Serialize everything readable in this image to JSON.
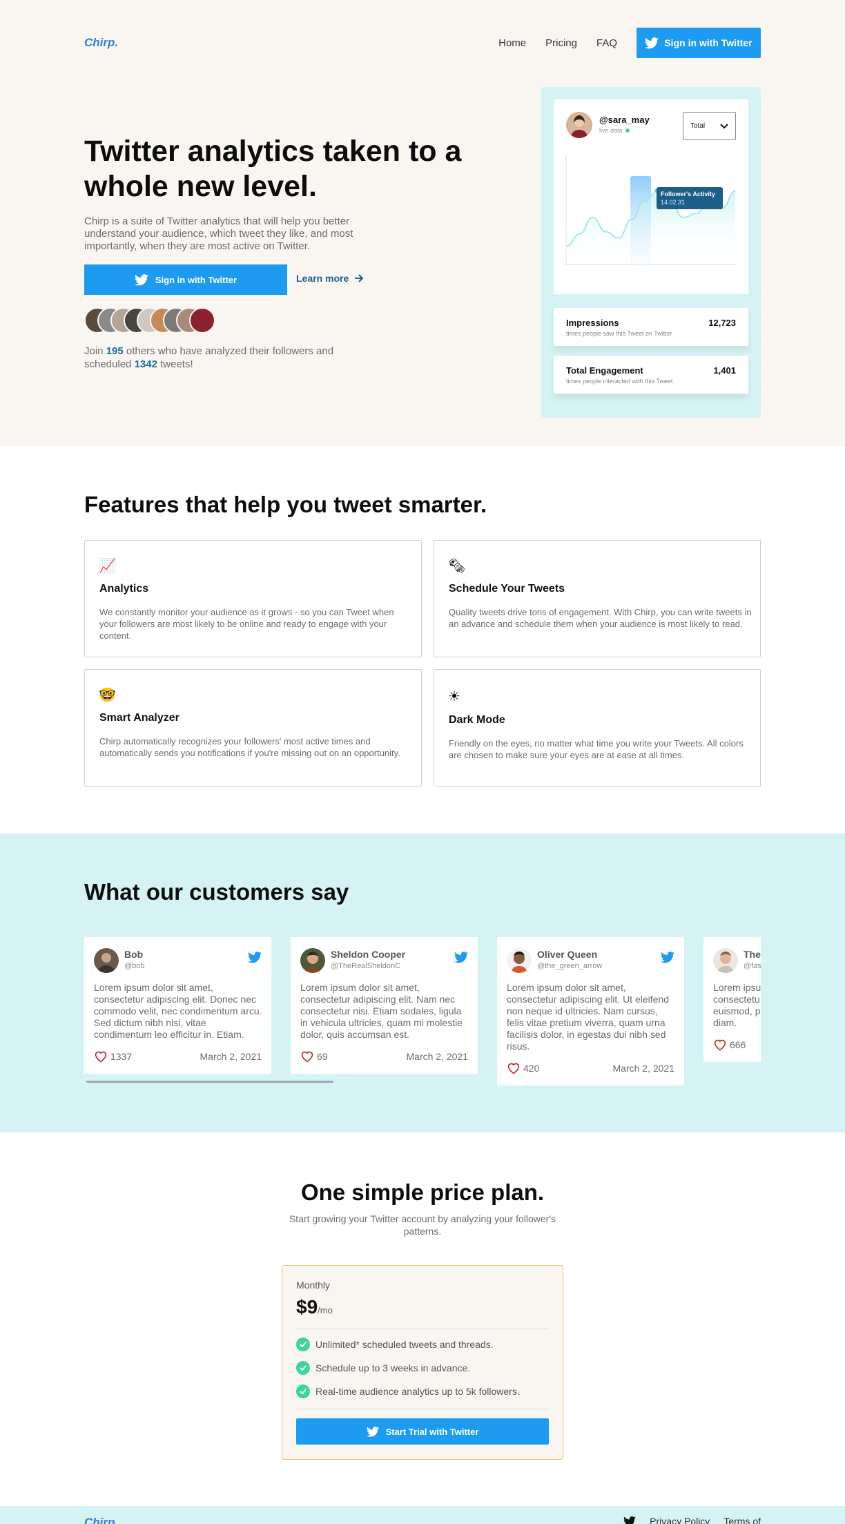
{
  "nav": {
    "logo": "Chirp.",
    "links": [
      "Home",
      "Pricing",
      "FAQ"
    ],
    "signin": "Sign in with Twitter"
  },
  "hero": {
    "title": "Twitter analytics taken to a whole new level.",
    "description": "Chirp is a suite of Twitter analytics that will help you better understand your audience, which tweet they like, and most importantly, when they are most active on Twitter.",
    "signin": "Sign in with Twitter",
    "learn_more": "Learn more",
    "join_prefix": "Join",
    "users_count": "195",
    "join_middle": "others who have analyzed their followers and scheduled",
    "tweets_count": "1342",
    "join_suffix": "tweets!"
  },
  "analytics_card": {
    "username": "@sara_may",
    "status": "live data",
    "select_value": "Total",
    "tooltip_title": "Follower's Activity",
    "tooltip_value": "14.02.31",
    "activity": [
      0.18,
      0.3,
      0.46,
      0.32,
      0.26,
      0.44,
      0.62,
      0.72,
      0.6,
      0.46,
      0.5,
      0.64,
      0.55,
      0.72
    ],
    "stats": [
      {
        "name": "Impressions",
        "value": "12,723",
        "sub": "times people saw this Tweet on Twitter"
      },
      {
        "name": "Total Engagement",
        "value": "1,401",
        "sub": "times people interacted with this Tweet"
      }
    ]
  },
  "features": {
    "title": "Features that help you tweet smarter.",
    "items": [
      {
        "icon": "📈",
        "name": "Analytics",
        "desc": "We constantly monitor your audience as it grows - so you can Tweet when your followers are most likely to be online and ready to engage with your content."
      },
      {
        "icon": "🗞",
        "name": "Schedule Your Tweets",
        "desc": "Quality tweets drive tons of engagement. With Chirp, you can write tweets in an advance and schedule them when your audience is most likely to read."
      },
      {
        "icon": "🤓",
        "name": "Smart Analyzer",
        "desc": "Chirp automatically recognizes your followers' most active times and automatically sends you notifications if you're missing out on an opportunity."
      },
      {
        "icon": "☀",
        "name": "Dark Mode",
        "desc": "Friendly on the eyes, no matter what time you write your Tweets. All colors are chosen to make sure your eyes are at ease at all times."
      }
    ]
  },
  "testimonials": {
    "title": "What our customers say",
    "items": [
      {
        "name": "Bob",
        "handle": "@bob",
        "text": "Lorem ipsum dolor sit amet, consectetur adipiscing elit. Donec nec commodo velit, nec condimentum arcu. Sed dictum nibh nisi, vitae condimentum leo efficitur in. Etiam.",
        "likes": "1337",
        "date": "March 2, 2021"
      },
      {
        "name": "Sheldon Cooper",
        "handle": "@TheRealSheldonC",
        "text": "Lorem ipsum dolor sit amet, consectetur adipiscing elit. Nam nec consectetur nisi. Etiam sodales, ligula in vehicula ultricies, quam mi molestie dolor, quis accumsan est.",
        "likes": "69",
        "date": "March 2, 2021"
      },
      {
        "name": "Oliver Queen",
        "handle": "@the_green_arrow",
        "text": "Lorem ipsum dolor sit amet, consectetur adipiscing elit. Ut eleifend non neque id ultricies. Nam cursus, felis vitae pretium viverra, quam urna facilisis dolor, in egestas dui nibh sed risus.",
        "likes": "420",
        "date": "March 2, 2021"
      },
      {
        "name": "The",
        "handle": "@fas",
        "text": "Lorem ipsu consectetu euismod, p diam.",
        "likes": "666",
        "date": ""
      }
    ]
  },
  "pricing": {
    "title": "One simple price plan.",
    "subtitle": "Start growing your Twitter account by analyzing your follower's patterns.",
    "plan": "Monthly",
    "price": "$9",
    "per": "/mo",
    "features": [
      "Unlimited* scheduled tweets and threads.",
      "Schedule up to 3 weeks in advance.",
      "Real-time audience analytics up to 5k followers."
    ],
    "button": "Start Trial with Twitter"
  },
  "footer": {
    "logo": "Chirp.",
    "links": [
      "Privacy Policy",
      "Terms of"
    ]
  },
  "colors": {
    "accent": "#1d9bf0",
    "hero_bg": "#f9f6f2",
    "mint": "#d5f3f4",
    "success": "#3ed3a0",
    "heart": "#c0202a"
  }
}
